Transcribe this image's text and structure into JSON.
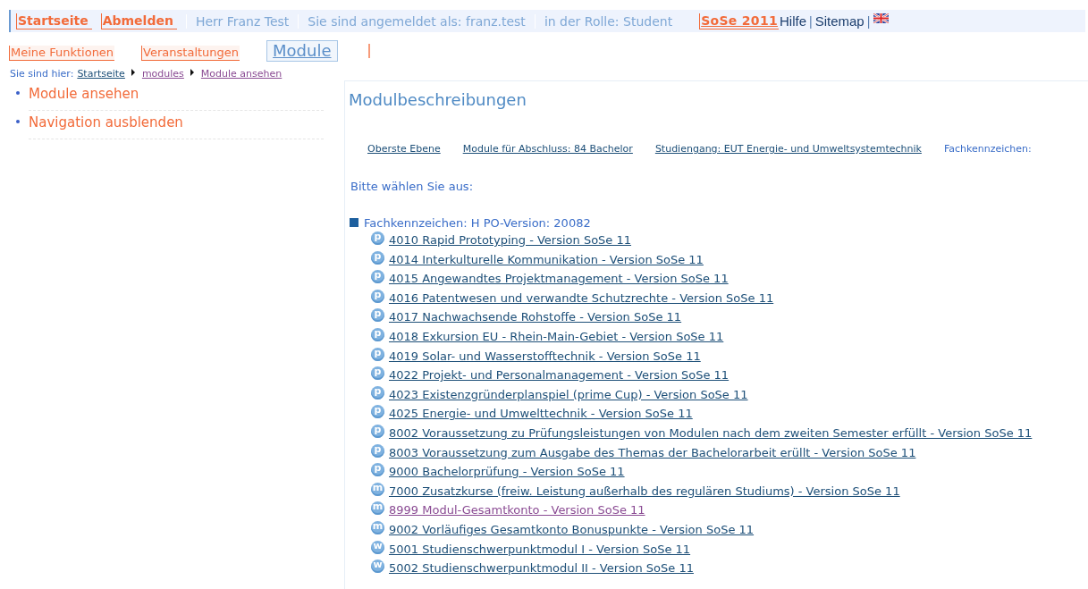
{
  "top_bar": {
    "items": [
      {
        "kind": "strong-link",
        "label": "Startseite"
      },
      {
        "kind": "strong-link",
        "label": "Abmelden"
      },
      {
        "kind": "info",
        "label": "Herr Franz Test"
      },
      {
        "kind": "info",
        "label": "Sie sind angemeldet als: franz.test"
      },
      {
        "kind": "info",
        "label": "in der Rolle: Student"
      },
      {
        "kind": "semester",
        "label": "SoSe 2011"
      },
      {
        "kind": "link",
        "label": "Hilfe"
      },
      {
        "kind": "separator",
        "label": "|"
      },
      {
        "kind": "link",
        "label": "Sitemap"
      },
      {
        "kind": "separator",
        "label": "|"
      },
      {
        "kind": "flag"
      }
    ]
  },
  "main_nav": {
    "tabs": [
      {
        "label": "Meine Funktionen",
        "selected": false
      },
      {
        "label": "Veranstaltungen",
        "selected": false
      },
      {
        "label": "Module",
        "selected": true
      }
    ]
  },
  "breadcrumb": {
    "label": "Sie sind hier:",
    "links": [
      {
        "label": "Startseite",
        "visited": false
      },
      {
        "label": "modules",
        "visited": true
      },
      {
        "label": "Module ansehen",
        "visited": true
      }
    ]
  },
  "sidebar": {
    "items": [
      "Module ansehen",
      "Navigation ausblenden"
    ]
  },
  "content": {
    "title": "Modulbeschreibungen",
    "path": [
      "Oberste Ebene",
      "Module für Abschluss: 84 Bachelor",
      "Studiengang: EUT Energie- und Umweltsystemtechnik",
      "Fachkennzeichen:"
    ],
    "prompt": "Bitte wählen Sie aus:",
    "tree": {
      "label": "Fachkennzeichen: H PO-Version: 20082",
      "expanded": true,
      "children": [
        {
          "badge": "p",
          "label": "4010 Rapid Prototyping - Version SoSe 11",
          "visited": false
        },
        {
          "badge": "p",
          "label": "4014 Interkulturelle Kommunikation - Version SoSe 11",
          "visited": false
        },
        {
          "badge": "p",
          "label": "4015 Angewandtes Projektmanagement - Version SoSe 11",
          "visited": false
        },
        {
          "badge": "p",
          "label": "4016 Patentwesen und verwandte Schutzrechte - Version SoSe 11",
          "visited": false
        },
        {
          "badge": "p",
          "label": "4017 Nachwachsende Rohstoffe - Version SoSe 11",
          "visited": false
        },
        {
          "badge": "p",
          "label": "4018 Exkursion EU - Rhein-Main-Gebiet - Version SoSe 11",
          "visited": false
        },
        {
          "badge": "p",
          "label": "4019 Solar- und Wasserstofftechnik - Version SoSe 11",
          "visited": false
        },
        {
          "badge": "p",
          "label": "4022 Projekt- und Personalmanagement - Version SoSe 11",
          "visited": false
        },
        {
          "badge": "p",
          "label": "4023 Existenzgründerplanspiel (prime Cup) - Version SoSe 11",
          "visited": false
        },
        {
          "badge": "p",
          "label": "4025 Energie- und Umwelttechnik - Version SoSe 11",
          "visited": false
        },
        {
          "badge": "p",
          "label": "8002 Voraussetzung zu Prüfungsleistungen von Modulen nach dem zweiten Semester erfüllt - Version SoSe 11",
          "visited": false
        },
        {
          "badge": "p",
          "label": "8003 Voraussetzung zum Ausgabe des Themas der Bachelorarbeit erüllt - Version SoSe 11",
          "visited": false
        },
        {
          "badge": "p",
          "label": "9000 Bachelorprüfung - Version SoSe 11",
          "visited": false
        },
        {
          "badge": "m",
          "label": "7000 Zusatzkurse (freiw. Leistung außerhalb des regulären Studiums) - Version SoSe 11",
          "visited": false
        },
        {
          "badge": "m",
          "label": "8999 Modul-Gesamtkonto - Version SoSe 11",
          "visited": true
        },
        {
          "badge": "m",
          "label": "9002 Vorläufiges Gesamtkonto Bonuspunkte - Version SoSe 11",
          "visited": false
        },
        {
          "badge": "w",
          "label": "5001 Studienschwerpunktmodul I - Version SoSe 11",
          "visited": false
        },
        {
          "badge": "w",
          "label": "5002 Studienschwerpunktmodul II - Version SoSe 11",
          "visited": false
        }
      ]
    }
  }
}
